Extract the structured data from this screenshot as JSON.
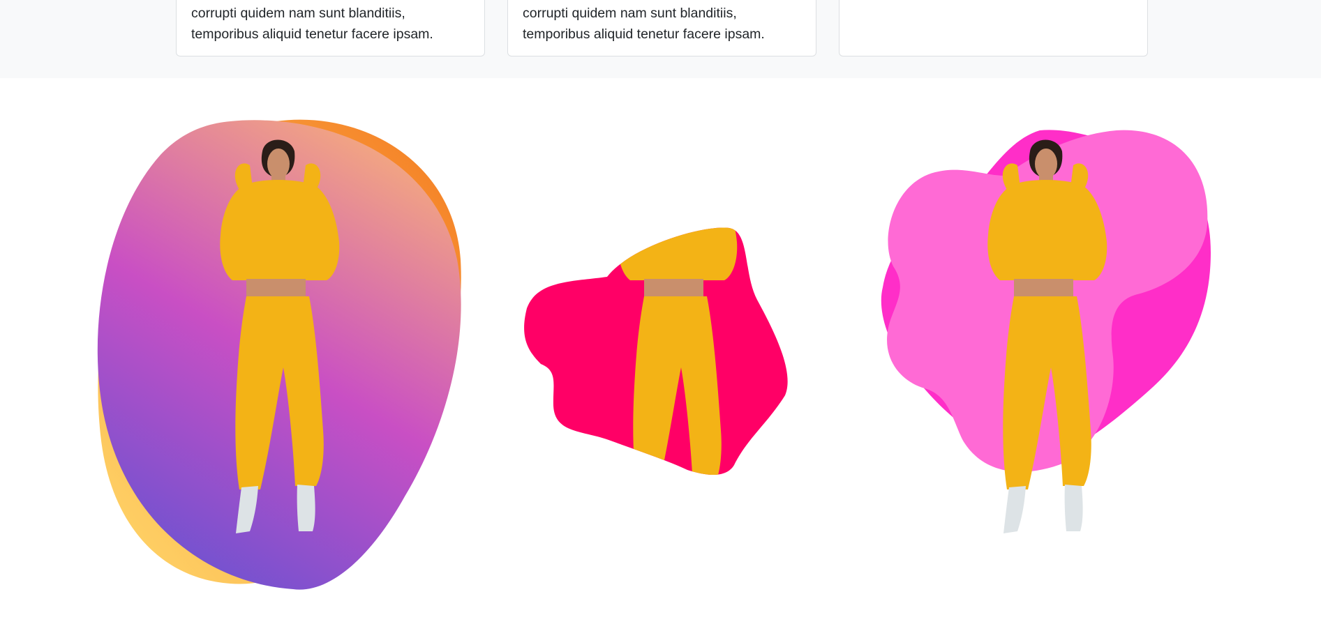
{
  "cards": [
    {
      "text_line1": "corrupti quidem nam sunt blanditiis,",
      "text_line2": "temporibus aliquid tenetur facere ipsam."
    },
    {
      "text_line1": "corrupti quidem nam sunt blanditiis,",
      "text_line2": "temporibus aliquid tenetur facere ipsam."
    },
    {
      "text_line1": "",
      "text_line2": ""
    }
  ],
  "colors": {
    "section_background": "#f8f9fa",
    "card_border": "#dcdfe2",
    "text": "#212529",
    "gradient_blob_back_start": "#ffd86b",
    "gradient_blob_back_end": "#f47c22",
    "gradient_blob_front_top": "#f4a97f",
    "gradient_blob_front_middle": "#c94fc4",
    "gradient_blob_front_bottom": "#6b52d1",
    "pink_blob": "#ff0066",
    "magenta_blob_back": "#ff2ec8",
    "magenta_blob_front": "#ff6ad5",
    "hoodie_yellow": "#f3b316",
    "skin": "#c98f6c",
    "boots": "#dde3e6",
    "hair": "#2a1d18"
  }
}
